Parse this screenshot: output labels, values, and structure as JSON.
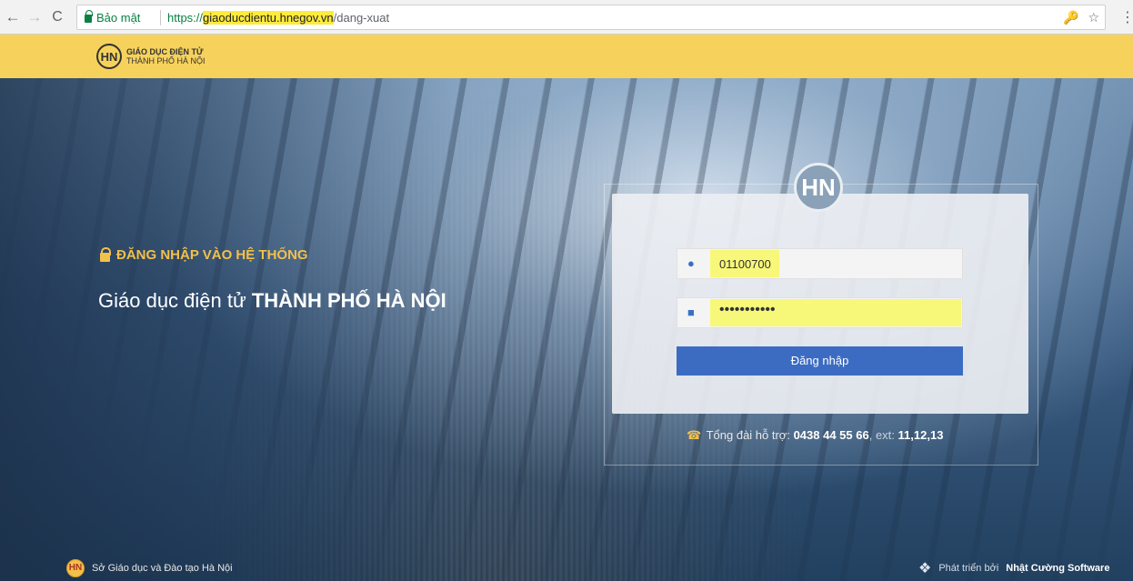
{
  "browser": {
    "back_glyph": "←",
    "forward_glyph": "→",
    "reload_glyph": "C",
    "secure_label": "Bảo mật",
    "url_scheme": "https://",
    "url_host": "giaoducdientu.hnegov.vn",
    "url_path": "/dang-xuat",
    "icons": [
      "key-icon",
      "star-icon"
    ],
    "key_glyph": "🔑",
    "star_glyph": "☆",
    "menu_glyph": "⋮"
  },
  "header": {
    "logo_mark": "HN",
    "logo_line1": "GIÁO DỤC ĐIỆN TỬ",
    "logo_line2": "THÀNH PHỐ HÀ NỘI",
    "background_color": "#f6d25c"
  },
  "hero": {
    "tagline": "ĐĂNG NHẬP VÀO HỆ THỐNG",
    "headline_prefix": "Giáo dục điện tử",
    "headline_bold": "THÀNH PHỐ HÀ NỘI",
    "tagline_color": "#f3c04b"
  },
  "login": {
    "emblem": "HN",
    "username_icon": "user-icon",
    "username_value": "01100700",
    "password_icon": "lock-icon",
    "password_value": "•••••••••••",
    "submit_label": "Đăng nhập",
    "button_color": "#3c6cc2"
  },
  "support": {
    "label": "Tổng đài hỗ trợ:",
    "phone": "0438 44 55 66",
    "ext_label": ", ext:",
    "ext_value": "11,12,13"
  },
  "footer": {
    "left_emblem": "HN",
    "left_text": "Sở Giáo dục và Đào tạo Hà Nội",
    "right_prefix": "Phát triển bởi",
    "right_brand": "Nhật Cường Software"
  }
}
